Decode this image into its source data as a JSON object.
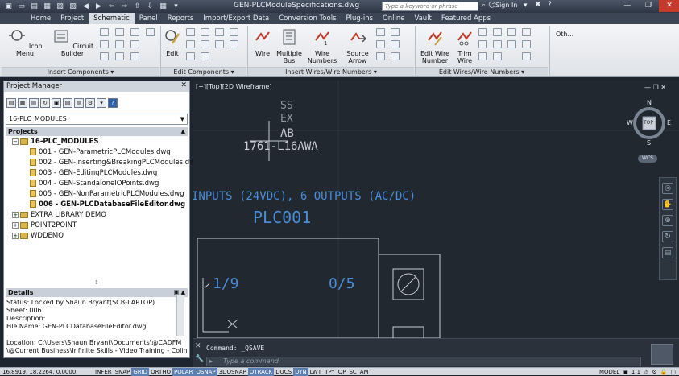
{
  "title_bar": {
    "document_title": "GEN-PLCModuleSpecifications.dwg",
    "search_placeholder": "Type a keyword or phrase",
    "sign_in": "Sign In"
  },
  "ribbon_tabs": [
    "Home",
    "Project",
    "Schematic",
    "Panel",
    "Reports",
    "Import/Export Data",
    "Conversion Tools",
    "Plug-ins",
    "Online",
    "Vault",
    "Featured Apps"
  ],
  "active_tab": "Schematic",
  "ribbon": {
    "icon_menu": "Icon Menu",
    "circuit_builder": "Circuit Builder",
    "insert_components": "Insert Components",
    "edit": "Edit",
    "edit_components": "Edit Components",
    "wire": "Wire",
    "multiple_bus": "Multiple Bus",
    "wire_numbers": "Wire Numbers",
    "source_arrow": "Source Arrow",
    "insert_wires": "Insert Wires/Wire Numbers",
    "edit_wire_number": "Edit Wire Number",
    "trim_wire": "Trim Wire",
    "edit_wires": "Edit Wires/Wire Numbers",
    "other": "Oth..."
  },
  "project_manager": {
    "title": "Project Manager",
    "project_select": "16-PLC_MODULES",
    "projects_header": "Projects",
    "tree": [
      {
        "label": "16-PLC_MODULES",
        "bold": true
      },
      {
        "label": "001 - GEN-ParametricPLCModules.dwg"
      },
      {
        "label": "002 - GEN-Inserting&BreakingPLCModules.dwg"
      },
      {
        "label": "003 - GEN-EditingPLCModules.dwg"
      },
      {
        "label": "004 - GEN-StandaloneIOPoints.dwg"
      },
      {
        "label": "005 - GEN-NonParametricPLCModules.dwg"
      },
      {
        "label": "006 - GEN-PLCDatabaseFileEditor.dwg",
        "bold": true
      },
      {
        "label": "EXTRA LIBRARY DEMO"
      },
      {
        "label": "POINT2POINT"
      },
      {
        "label": "WDDEMO"
      }
    ],
    "details_header": "Details",
    "details": [
      "Status: Locked by Shaun Bryant(SCB-LAPTOP)",
      "Sheet: 006",
      "Description:",
      "File Name: GEN-PLCDatabaseFileEditor.dwg",
      "",
      "Location: C:\\Users\\Shaun Bryant\\Documents\\@CADFM",
      "\\@Current Business\\Infinite Skills - Video Training - Colin"
    ]
  },
  "viewport": {
    "label": "[−][Top][2D Wireframe]",
    "cad_ss": "SS",
    "cad_ex": "EX",
    "cad_ab": "AB",
    "cad_part": "1761-L16AWA",
    "cad_io": "INPUTS (24VDC), 6 OUTPUTS (AC/DC)",
    "cad_plc": "PLC001",
    "cad_left_num": "1/9",
    "cad_right_num": "0/5",
    "viewcube": {
      "n": "N",
      "s": "S",
      "e": "E",
      "w": "W",
      "top": "TOP",
      "wcs": "WCS"
    }
  },
  "command": {
    "history": "Command:  _QSAVE",
    "placeholder": "Type a command"
  },
  "status_bar": {
    "coords": "16.8919, 18.2264, 0.0000",
    "toggles": [
      {
        "label": "INFER",
        "on": false
      },
      {
        "label": "SNAP",
        "on": false
      },
      {
        "label": "GRID",
        "on": true
      },
      {
        "label": "ORTHO",
        "on": false
      },
      {
        "label": "POLAR",
        "on": true
      },
      {
        "label": "OSNAP",
        "on": true
      },
      {
        "label": "3DOSNAP",
        "on": false
      },
      {
        "label": "OTRACK",
        "on": true
      },
      {
        "label": "DUCS",
        "on": false
      },
      {
        "label": "DYN",
        "on": true
      },
      {
        "label": "LWT",
        "on": false
      },
      {
        "label": "TPY",
        "on": false
      },
      {
        "label": "QP",
        "on": false
      },
      {
        "label": "SC",
        "on": false
      },
      {
        "label": "AM",
        "on": false
      }
    ],
    "model": "MODEL",
    "scale": "1:1"
  },
  "colors": {
    "cad_white": "#c7ccd4",
    "cad_blue": "#4a8cd8",
    "accent": "#5b7fb0"
  }
}
